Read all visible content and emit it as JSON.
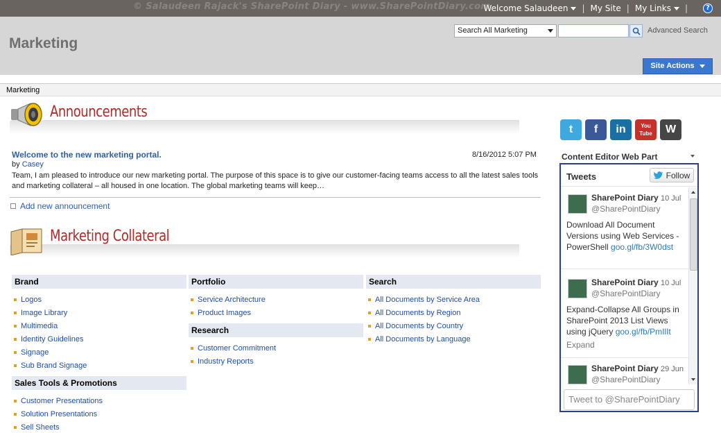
{
  "watermark": "© Salaudeen Rajack's SharePoint Diary - www.SharePointDiary.com",
  "topnav": {
    "welcome": "Welcome Salaudeen",
    "my_site": "My Site",
    "my_links": "My Links",
    "help": "?"
  },
  "site": {
    "title": "Marketing",
    "search_scope": "Search All Marketing",
    "search_value": "",
    "advanced_search": "Advanced Search",
    "site_actions": "Site Actions"
  },
  "breadcrumb": "Marketing",
  "announcements": {
    "heading": "Announcements",
    "item": {
      "title": "Welcome to the new marketing portal.",
      "date": "8/16/2012 5:07 PM",
      "by_label": "by",
      "author": "Casey",
      "body": "Team, I am pleased to introduce our new marketing portal. The purpose of this space is to give our customer-facing teams access to all the latest sales tools and marketing collateral – all housed in one location. The global marketing teams will keep…"
    },
    "add_new": "Add new announcement"
  },
  "collateral": {
    "heading": "Marketing Collateral",
    "groups": {
      "brand": {
        "title": "Brand",
        "links": [
          "Logos",
          "Image Library",
          "Multimedia",
          "Identity Guidelines",
          "Signage",
          "Sub Brand Signage"
        ]
      },
      "sales": {
        "title": "Sales Tools & Promotions",
        "links": [
          "Customer Presentations",
          "Solution Presentations",
          "Sell Sheets"
        ]
      },
      "portfolio": {
        "title": "Portfolio",
        "links": [
          "Service Architecture",
          "Product Images"
        ]
      },
      "research": {
        "title": "Research",
        "links": [
          "Customer Commitment",
          "Industry Reports"
        ]
      },
      "search": {
        "title": "Search",
        "links": [
          "All Documents by Service Area",
          "All Documents by Region",
          "All Documents by Country",
          "All Documents by Language"
        ]
      }
    }
  },
  "social": {
    "icons": [
      {
        "name": "twitter-icon",
        "glyph": "t",
        "color": "#3fa9df"
      },
      {
        "name": "facebook-icon",
        "glyph": "f",
        "color": "#3b5998"
      },
      {
        "name": "linkedin-icon",
        "glyph": "in",
        "color": "#1a6fa5"
      },
      {
        "name": "youtube-icon",
        "glyph": "You Tube",
        "color": "#c4302b"
      },
      {
        "name": "wordpress-icon",
        "glyph": "W",
        "color": "#464646"
      }
    ]
  },
  "cewp": {
    "title": "Content Editor Web Part",
    "tweets_title": "Tweets",
    "follow": "Follow",
    "tweets": [
      {
        "name": "SharePoint Diary",
        "date": "10 Jul",
        "handle": "@SharePointDiary",
        "text": "Download All Document Versions using Web Services - PowerShell ",
        "link": "goo.gl/fb/3W0dst",
        "expand": ""
      },
      {
        "name": "SharePoint Diary",
        "date": "10 Jul",
        "handle": "@SharePointDiary",
        "text": "Expand-Collapse All Groups in SharePoint 2013 List Views using jQuery ",
        "link": "goo.gl/fb/PmIlIt",
        "expand": "Expand"
      },
      {
        "name": "SharePoint Diary",
        "date": "29 Jun",
        "handle": "@SharePointDiary",
        "text": "",
        "link": "",
        "expand": ""
      }
    ],
    "tweet_placeholder": "Tweet to @SharePointDiary"
  }
}
